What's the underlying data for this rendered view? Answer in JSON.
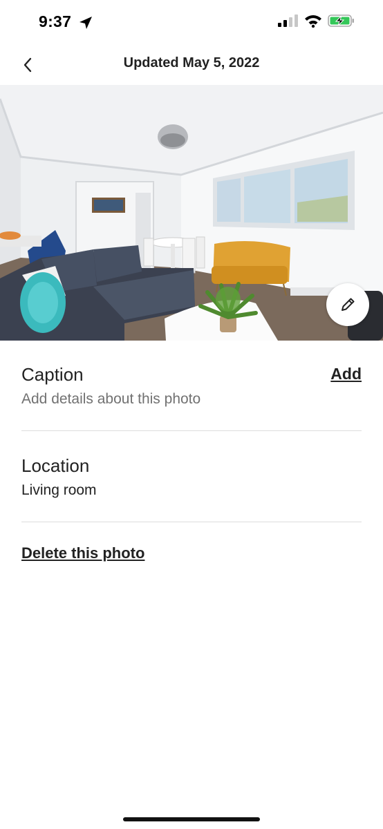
{
  "status_bar": {
    "time": "9:37",
    "icons": [
      "location-arrow-icon",
      "cellular-signal-icon",
      "wifi-icon",
      "battery-charging-icon"
    ]
  },
  "nav": {
    "back_icon": "chevron-left-icon",
    "title": "Updated May 5, 2022"
  },
  "photo": {
    "subject": "living room",
    "edit_icon": "pencil-icon"
  },
  "caption": {
    "title": "Caption",
    "placeholder": "Add details about this photo",
    "action_label": "Add"
  },
  "location": {
    "title": "Location",
    "value": "Living room"
  },
  "delete_label": "Delete this photo",
  "colors": {
    "text_primary": "#222222",
    "text_secondary": "#717171",
    "divider": "#dddddd",
    "battery_green": "#34c759"
  }
}
